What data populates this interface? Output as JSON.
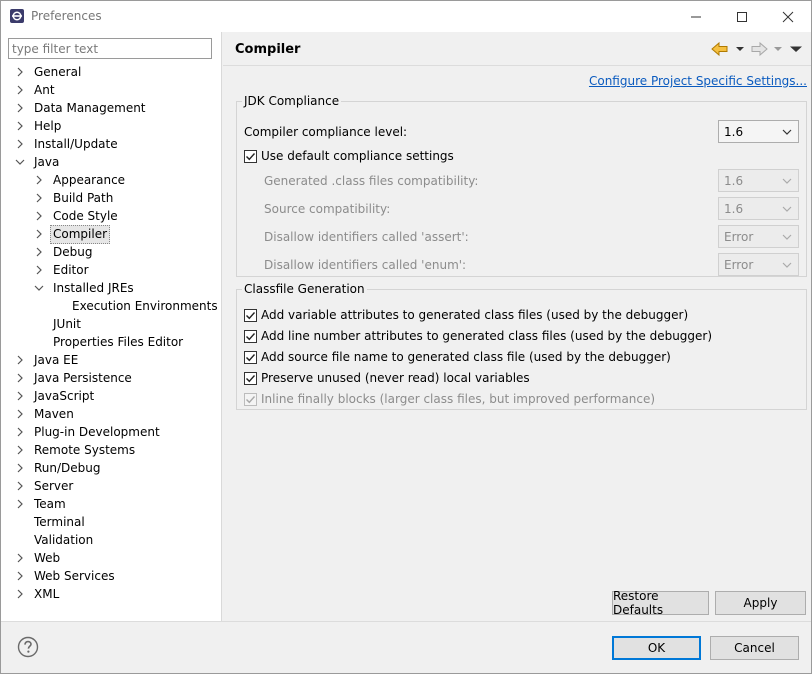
{
  "window": {
    "title": "Preferences"
  },
  "filter": {
    "placeholder": "type filter text",
    "value": ""
  },
  "tree": {
    "items": [
      {
        "label": "General",
        "level": 0,
        "state": "collapsed"
      },
      {
        "label": "Ant",
        "level": 0,
        "state": "collapsed"
      },
      {
        "label": "Data Management",
        "level": 0,
        "state": "collapsed"
      },
      {
        "label": "Help",
        "level": 0,
        "state": "collapsed"
      },
      {
        "label": "Install/Update",
        "level": 0,
        "state": "collapsed"
      },
      {
        "label": "Java",
        "level": 0,
        "state": "expanded"
      },
      {
        "label": "Appearance",
        "level": 1,
        "state": "collapsed"
      },
      {
        "label": "Build Path",
        "level": 1,
        "state": "collapsed"
      },
      {
        "label": "Code Style",
        "level": 1,
        "state": "collapsed"
      },
      {
        "label": "Compiler",
        "level": 1,
        "state": "collapsed",
        "selected": true
      },
      {
        "label": "Debug",
        "level": 1,
        "state": "collapsed"
      },
      {
        "label": "Editor",
        "level": 1,
        "state": "collapsed"
      },
      {
        "label": "Installed JREs",
        "level": 1,
        "state": "expanded"
      },
      {
        "label": "Execution Environments",
        "level": 2,
        "state": "leaf"
      },
      {
        "label": "JUnit",
        "level": 1,
        "state": "leaf"
      },
      {
        "label": "Properties Files Editor",
        "level": 1,
        "state": "leaf"
      },
      {
        "label": "Java EE",
        "level": 0,
        "state": "collapsed"
      },
      {
        "label": "Java Persistence",
        "level": 0,
        "state": "collapsed"
      },
      {
        "label": "JavaScript",
        "level": 0,
        "state": "collapsed"
      },
      {
        "label": "Maven",
        "level": 0,
        "state": "collapsed"
      },
      {
        "label": "Plug-in Development",
        "level": 0,
        "state": "collapsed"
      },
      {
        "label": "Remote Systems",
        "level": 0,
        "state": "collapsed"
      },
      {
        "label": "Run/Debug",
        "level": 0,
        "state": "collapsed"
      },
      {
        "label": "Server",
        "level": 0,
        "state": "collapsed"
      },
      {
        "label": "Team",
        "level": 0,
        "state": "collapsed"
      },
      {
        "label": "Terminal",
        "level": 0,
        "state": "leaf"
      },
      {
        "label": "Validation",
        "level": 0,
        "state": "leaf"
      },
      {
        "label": "Web",
        "level": 0,
        "state": "collapsed"
      },
      {
        "label": "Web Services",
        "level": 0,
        "state": "collapsed"
      },
      {
        "label": "XML",
        "level": 0,
        "state": "collapsed"
      }
    ]
  },
  "page": {
    "title": "Compiler",
    "configure_link": "Configure Project Specific Settings...",
    "jdk": {
      "group_label": "JDK Compliance",
      "compliance_label": "Compiler compliance level:",
      "compliance_value": "1.6",
      "use_default_label": "Use default compliance settings",
      "use_default_checked": true,
      "generated_label": "Generated .class files compatibility:",
      "generated_value": "1.6",
      "source_label": "Source compatibility:",
      "source_value": "1.6",
      "assert_label": "Disallow identifiers called 'assert':",
      "assert_value": "Error",
      "enum_label": "Disallow identifiers called 'enum':",
      "enum_value": "Error"
    },
    "classfile": {
      "group_label": "Classfile Generation",
      "options": [
        {
          "label": "Add variable attributes to generated class files (used by the debugger)",
          "checked": true,
          "enabled": true
        },
        {
          "label": "Add line number attributes to generated class files (used by the debugger)",
          "checked": true,
          "enabled": true
        },
        {
          "label": "Add source file name to generated class file (used by the debugger)",
          "checked": true,
          "enabled": true
        },
        {
          "label": "Preserve unused (never read) local variables",
          "checked": true,
          "enabled": true
        },
        {
          "label": "Inline finally blocks (larger class files, but improved performance)",
          "checked": true,
          "enabled": false
        }
      ]
    },
    "restore_defaults_label": "Restore Defaults",
    "apply_label": "Apply"
  },
  "footer": {
    "ok_label": "OK",
    "cancel_label": "Cancel"
  },
  "icons": {
    "app": "eclipse-icon",
    "help": "help-icon",
    "back": "back-arrow-icon",
    "forward": "forward-arrow-icon"
  },
  "colors": {
    "accent": "#0078d7",
    "link": "#0b5bbf",
    "back_arrow": "#e8a000"
  }
}
